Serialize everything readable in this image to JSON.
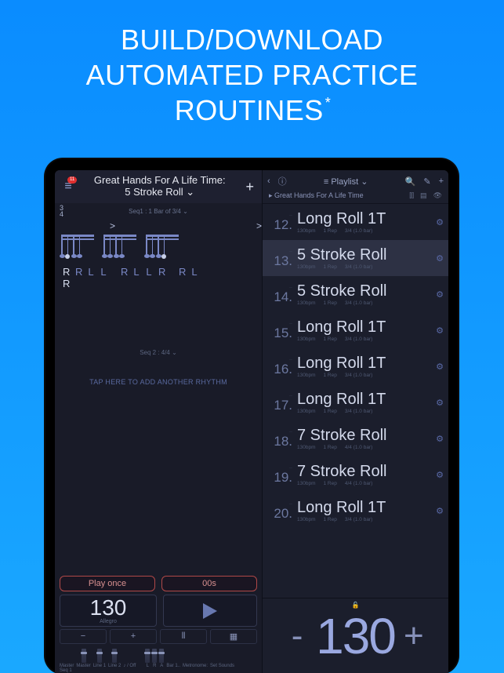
{
  "hero": {
    "line1": "BUILD/DOWNLOAD",
    "line2": "AUTOMATED PRACTICE",
    "line3": "ROUTINES",
    "asterisk": "*"
  },
  "left_header": {
    "badge": "11",
    "title_line1": "Great Hands For A Life Time:",
    "title_line2": "5 Stroke Roll ⌄",
    "plus": "+"
  },
  "seq1": {
    "ts_top": "3",
    "ts_bot": "4",
    "label": "Seq1 : 1 Bar of 3/4 ⌄"
  },
  "sticking": [
    "R",
    "R",
    "L",
    "L",
    "R",
    "L",
    "L",
    "R",
    "R",
    "L"
  ],
  "sticking_extra": "R",
  "seq2_label": "Seq 2 : 4/4 ⌄",
  "add_rhythm": "TAP HERE TO ADD ANOTHER RHYTHM",
  "transport": {
    "play_mode": "Play once",
    "timer": "00s",
    "bpm_value": "130",
    "bpm_label": "Allegro",
    "minus": "−",
    "plus": "+"
  },
  "mixer": {
    "master": "Master",
    "line1": "Line 1",
    "line2": "Line 2",
    "onoff": "♪ / Off",
    "bar_l": "L",
    "bar_r": "R",
    "bar_a": "A",
    "bar_num": "Bar    1..",
    "metro": "Metronome:",
    "sounds": "Set Sounds",
    "seq1": "Seq 1"
  },
  "right_header": {
    "playlist_label": "Playlist ⌄",
    "breadcrumb": "▸ Great Hands For A Life Time"
  },
  "playlist": [
    {
      "n": "12.",
      "name": "Long Roll 1T",
      "bpm": "130bpm",
      "rep": "1 Rep",
      "sig": "3/4 (1.0 bar)"
    },
    {
      "n": "13.",
      "name": "5 Stroke Roll",
      "bpm": "130bpm",
      "rep": "1 Rep",
      "sig": "3/4 (1.0 bar)",
      "sel": true
    },
    {
      "n": "14.",
      "name": "5 Stroke Roll",
      "bpm": "130bpm",
      "rep": "1 Rep",
      "sig": "3/4 (1.0 bar)"
    },
    {
      "n": "15.",
      "name": "Long Roll 1T",
      "bpm": "130bpm",
      "rep": "1 Rep",
      "sig": "3/4 (1.0 bar)"
    },
    {
      "n": "16.",
      "name": "Long Roll 1T",
      "bpm": "130bpm",
      "rep": "1 Rep",
      "sig": "3/4 (1.0 bar)"
    },
    {
      "n": "17.",
      "name": "Long Roll 1T",
      "bpm": "130bpm",
      "rep": "1 Rep",
      "sig": "3/4 (1.0 bar)"
    },
    {
      "n": "18.",
      "name": "7 Stroke Roll",
      "bpm": "130bpm",
      "rep": "1 Rep",
      "sig": "4/4 (1.0 bar)"
    },
    {
      "n": "19.",
      "name": "7 Stroke Roll",
      "bpm": "130bpm",
      "rep": "1 Rep",
      "sig": "4/4 (1.0 bar)"
    },
    {
      "n": "20.",
      "name": "Long Roll 1T",
      "bpm": "130bpm",
      "rep": "1 Rep",
      "sig": "3/4 (1.0 bar)"
    }
  ],
  "big_tempo": {
    "minus": "-",
    "value": "130",
    "plus": "+"
  }
}
